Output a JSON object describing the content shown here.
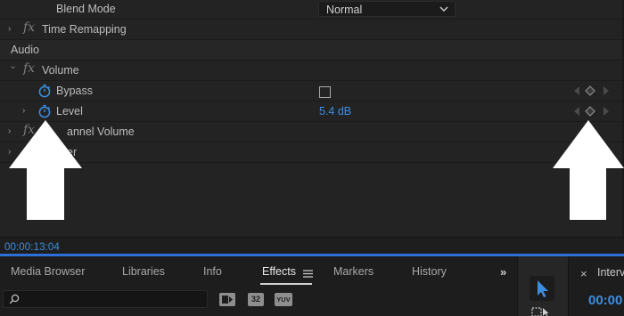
{
  "effect_controls": {
    "blend_mode": {
      "label": "Blend Mode",
      "value": "Normal"
    },
    "time_remapping": {
      "fx": "fx",
      "label": "Time Remapping"
    },
    "audio_section": "Audio",
    "volume": {
      "fx": "fx",
      "label": "Volume",
      "bypass_label": "Bypass",
      "bypass_checked": false,
      "level_label": "Level",
      "level_value": "5.4 dB"
    },
    "channel_volume": {
      "fx": "fx",
      "label": "annel Volume"
    },
    "panner": {
      "label": "er"
    },
    "timecode": "00:00:13:04"
  },
  "bottom_tabs": {
    "tabs": [
      "Media Browser",
      "Libraries",
      "Info",
      "Effects",
      "Markers",
      "History"
    ],
    "active_tab": "Effects",
    "overflow": "»",
    "search_placeholder": "",
    "badges": [
      "",
      "32",
      "YUV"
    ]
  },
  "right_panel": {
    "close": "×",
    "title": "Interv",
    "timecode": "00:00"
  },
  "icons": {
    "stopwatch": "stopwatch-icon",
    "keyframe_prev": "keyframe-prev-icon",
    "keyframe_add": "keyframe-add-icon",
    "keyframe_next": "keyframe-next-icon",
    "selection_tool": "selection-tool-icon",
    "track_select": "track-select-icon"
  },
  "colors": {
    "accent_blue": "#3d8ee0",
    "panel_bg": "#232323",
    "timeline_strip": "#2f6fd9",
    "arrow": "#ffffff"
  }
}
